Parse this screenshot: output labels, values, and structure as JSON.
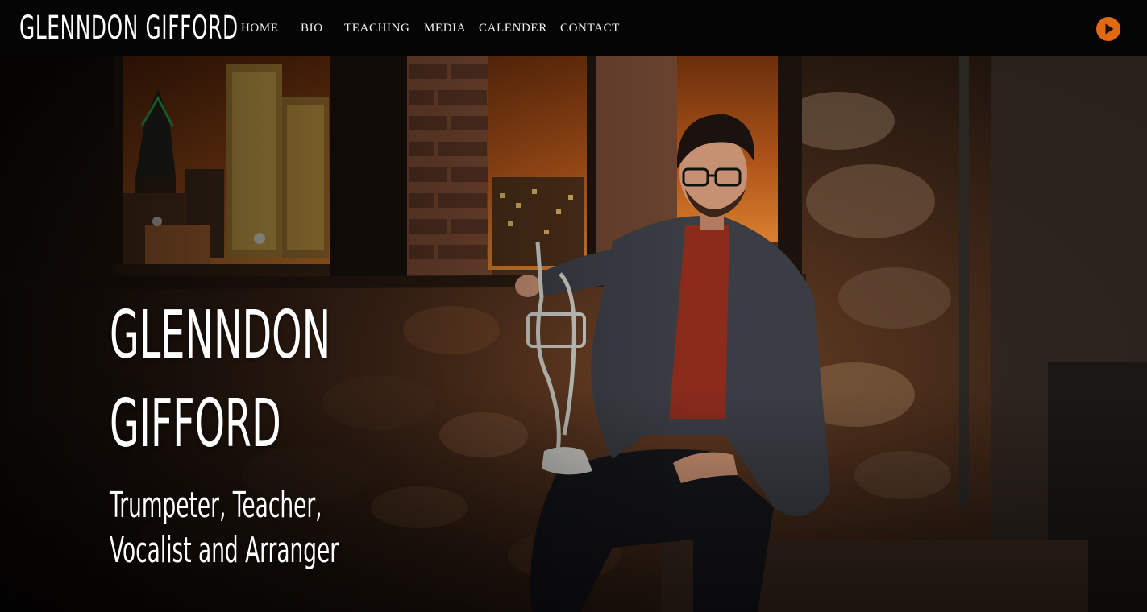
{
  "header": {
    "site_title": "GLENNDON GIFFORD",
    "nav": [
      {
        "label": "HOME"
      },
      {
        "label": "BIO"
      },
      {
        "label": "TEACHING"
      },
      {
        "label": "MEDIA"
      },
      {
        "label": "CALENDER"
      },
      {
        "label": "CONTACT"
      }
    ],
    "audio_player": {
      "icon": "play-icon",
      "color": "#e06a14"
    }
  },
  "hero": {
    "name_line1": "GLENNDON",
    "name_line2": "GIFFORD",
    "tagline_line1": "Trumpeter, Teacher,",
    "tagline_line2": "Vocalist and Arranger",
    "photo_description": "musician-with-trumpet-photo"
  },
  "colors": {
    "header_bg": "#050505",
    "accent": "#e06a14",
    "text": "#ffffff"
  }
}
